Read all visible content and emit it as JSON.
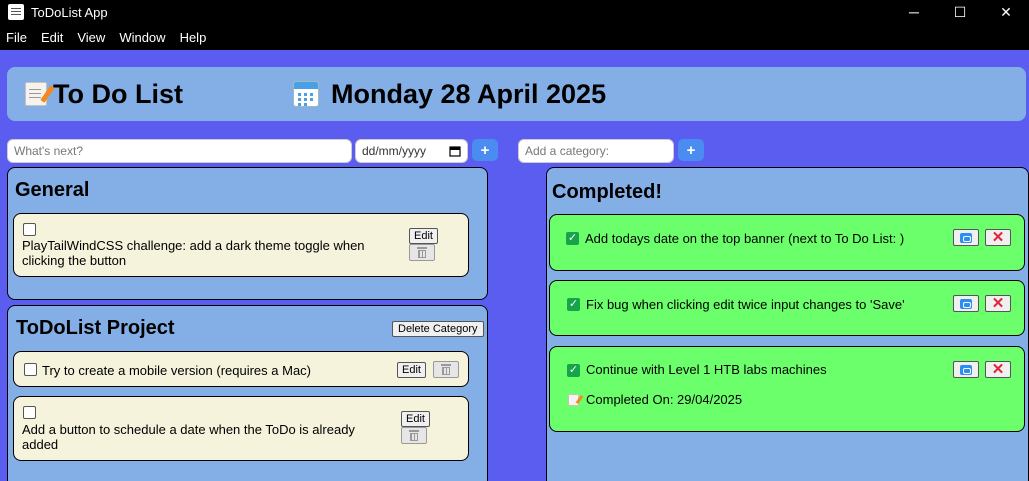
{
  "window": {
    "title": "ToDoList App",
    "controls": {
      "minimize": "─",
      "maximize": "☐",
      "close": "✕"
    }
  },
  "menu": [
    "File",
    "Edit",
    "View",
    "Window",
    "Help"
  ],
  "header": {
    "title": "To Do List",
    "date": "Monday 28 April 2025",
    "title_icon": "memo-icon",
    "date_icon": "calendar-icon"
  },
  "todo_input": {
    "placeholder": "What's next?",
    "date_placeholder": "dd/mm/yyyy",
    "add_label": "+"
  },
  "category_input": {
    "placeholder": "Add a category:",
    "add_label": "+"
  },
  "categories": [
    {
      "title": "General",
      "items": [
        {
          "text": "PlayTailWindCSS challenge: add a dark theme toggle when clicking the button",
          "checked": false,
          "edit_label": "Edit"
        }
      ]
    },
    {
      "title": "ToDoList Project",
      "delete_label": "Delete Category",
      "items": [
        {
          "text": "Try to create a mobile version (requires a Mac)",
          "checked": false,
          "edit_label": "Edit"
        },
        {
          "text": "Add a button to schedule a date when the ToDo is already added",
          "checked": false,
          "edit_label": "Edit"
        }
      ]
    }
  ],
  "completed": {
    "title": "Completed!",
    "items": [
      {
        "text": "Add todays date on the top banner (next to To Do List: )",
        "checked": true
      },
      {
        "text": "Fix bug when clicking edit twice input changes to 'Save'",
        "checked": true
      },
      {
        "text": "Continue with Level 1 HTB labs machines",
        "checked": true,
        "completed_on": "Completed On: 29/04/2025"
      }
    ],
    "check_glyph": "✓",
    "delete_glyph": "✕"
  },
  "colors": {
    "background": "#5b5df0",
    "panel": "#84aee6",
    "todo_card": "#f5f3dc",
    "completed_card": "#6bff6b",
    "add_button": "#4a8cf0"
  }
}
